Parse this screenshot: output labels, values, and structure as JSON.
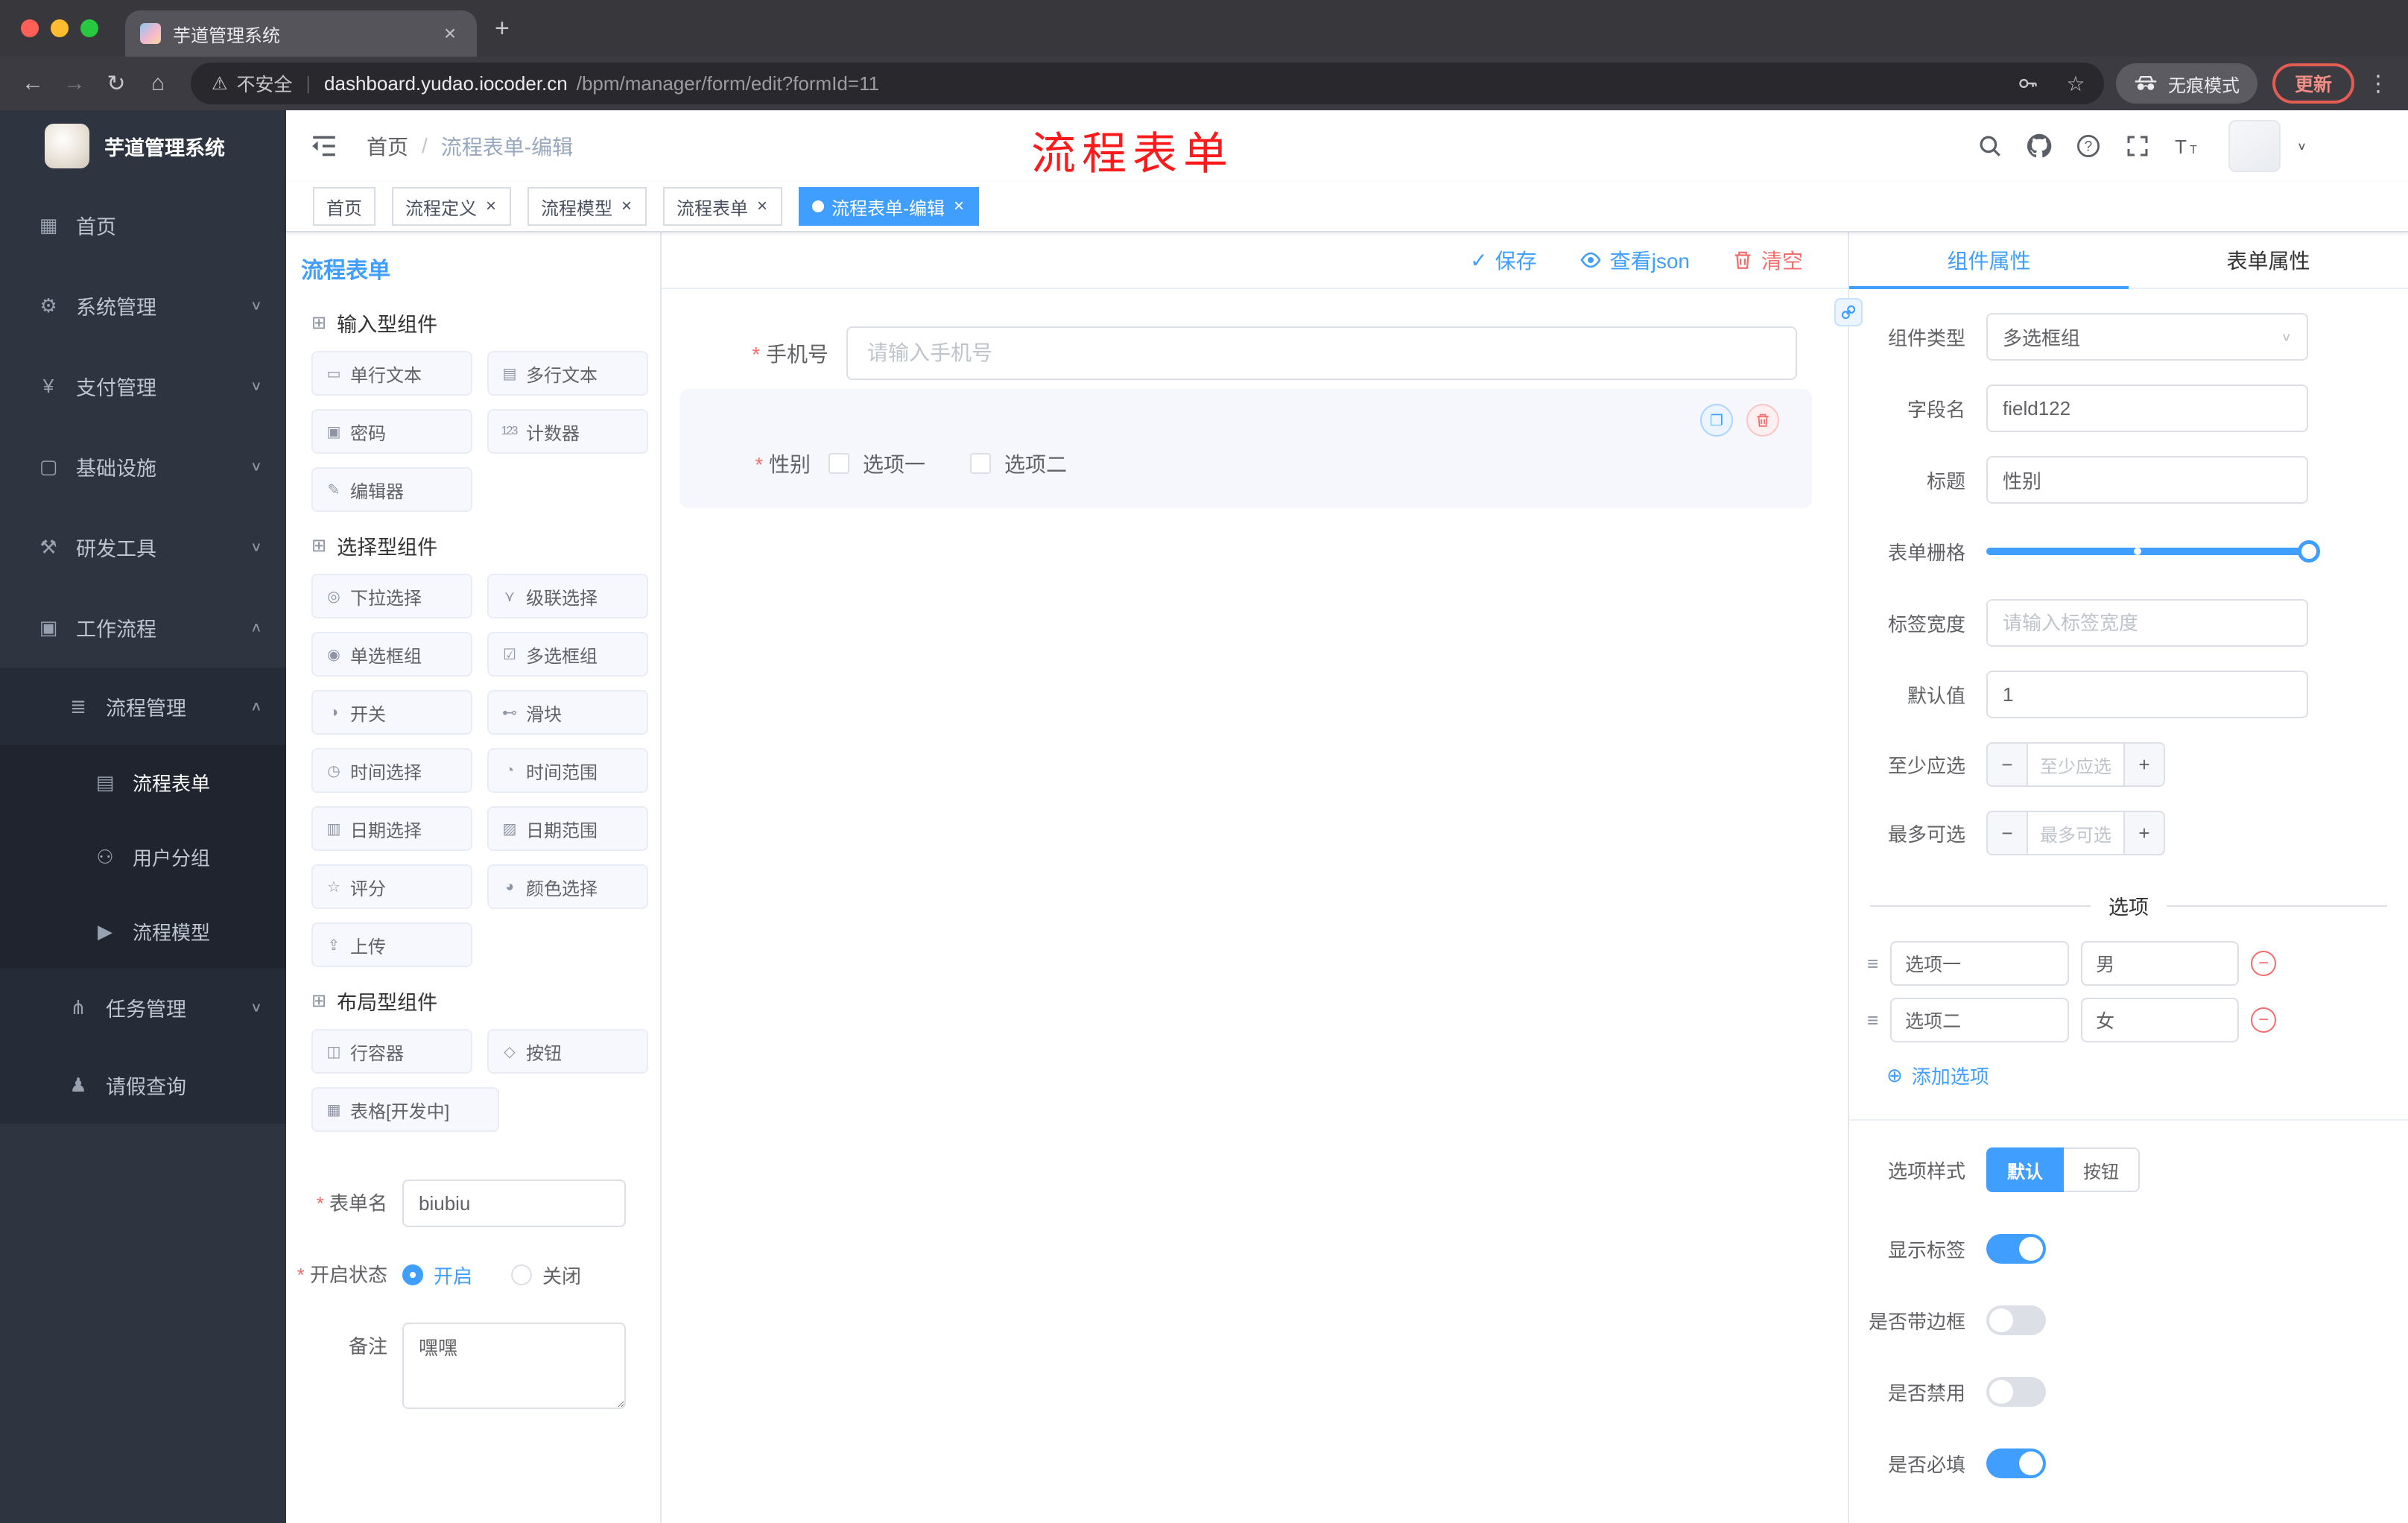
{
  "browser": {
    "tab_title": "芋道管理系统",
    "close_icon": "×",
    "new_tab_icon": "+",
    "back_icon": "←",
    "forward_icon": "→",
    "reload_icon": "↻",
    "home_icon": "⌂",
    "security_icon": "⚠",
    "security_label": "不安全",
    "security_sep": "|",
    "url_host": "dashboard.yudao.iocoder.cn",
    "url_path": "/bpm/manager/form/edit?formId=11",
    "bookmark_icon": "☆",
    "incognito_label": "无痕模式",
    "update_label": "更新",
    "menu_dots_icon": "⋮"
  },
  "sidebar": {
    "logo_title": "芋道管理系统",
    "items": [
      {
        "label": "首页",
        "icon": "▦"
      },
      {
        "label": "系统管理",
        "icon": "⚙",
        "chev": "∨"
      },
      {
        "label": "支付管理",
        "icon": "¥",
        "chev": "∨"
      },
      {
        "label": "基础设施",
        "icon": "▢",
        "chev": "∨"
      },
      {
        "label": "研发工具",
        "icon": "⚒",
        "chev": "∨"
      },
      {
        "label": "工作流程",
        "icon": "▣",
        "chev": "∧"
      },
      {
        "label": "流程管理",
        "icon": "≣",
        "chev": "∧"
      },
      {
        "label": "流程表单",
        "icon": "▤",
        "active": true
      },
      {
        "label": "用户分组",
        "icon": "⚇"
      },
      {
        "label": "流程模型",
        "icon": "▶"
      },
      {
        "label": "任务管理",
        "icon": "⋔",
        "chev": "∨"
      },
      {
        "label": "请假查询",
        "icon": "♟"
      }
    ]
  },
  "header": {
    "breadcrumb_root": "首页",
    "breadcrumb_sep": "/",
    "breadcrumb_current": "流程表单-编辑",
    "annotation": "流程表单",
    "avatar_caret": "∨"
  },
  "tags": {
    "items": [
      {
        "label": "首页"
      },
      {
        "label": "流程定义",
        "close": "×"
      },
      {
        "label": "流程模型",
        "close": "×"
      },
      {
        "label": "流程表单",
        "close": "×"
      },
      {
        "label": "流程表单-编辑",
        "close": "×",
        "active": true
      }
    ]
  },
  "designer": {
    "title": "流程表单",
    "group_icon": "⊞",
    "groups": [
      {
        "title": "输入型组件",
        "items": [
          {
            "label": "单行文本",
            "icon": "▭"
          },
          {
            "label": "多行文本",
            "icon": "▤"
          },
          {
            "label": "密码",
            "icon": "▣"
          },
          {
            "label": "计数器",
            "icon": "123"
          },
          {
            "label": "编辑器",
            "icon": "✎"
          }
        ]
      },
      {
        "title": "选择型组件",
        "items": [
          {
            "label": "下拉选择",
            "icon": "◎"
          },
          {
            "label": "级联选择",
            "icon": "⋎"
          },
          {
            "label": "单选框组",
            "icon": "◉"
          },
          {
            "label": "多选框组",
            "icon": "☑"
          },
          {
            "label": "开关",
            "icon": "◑"
          },
          {
            "label": "滑块",
            "icon": "⊷"
          },
          {
            "label": "时间选择",
            "icon": "◷"
          },
          {
            "label": "时间范围",
            "icon": "◔"
          },
          {
            "label": "日期选择",
            "icon": "▥"
          },
          {
            "label": "日期范围",
            "icon": "▨"
          },
          {
            "label": "评分",
            "icon": "☆"
          },
          {
            "label": "颜色选择",
            "icon": "◕"
          },
          {
            "label": "上传",
            "icon": "⇪"
          }
        ]
      },
      {
        "title": "布局型组件",
        "items": [
          {
            "label": "行容器",
            "icon": "◫"
          },
          {
            "label": "按钮",
            "icon": "◇"
          },
          {
            "label": "表格[开发中]",
            "icon": "▦"
          }
        ]
      }
    ],
    "form": {
      "name_label": "表单名",
      "name_value": "biubiu",
      "status_label": "开启状态",
      "on_label": "开启",
      "on_selected": true,
      "off_label": "关闭",
      "remark_label": "备注",
      "remark_value": "嘿嘿"
    }
  },
  "canvas": {
    "save_icon": "✓",
    "save_label": "保存",
    "view_json_label": "查看json",
    "clear_label": "清空",
    "copy_icon": "❐",
    "phone": {
      "label": "手机号",
      "placeholder": "请输入手机号"
    },
    "gender": {
      "label": "性别",
      "option1": "选项一",
      "option2": "选项二"
    }
  },
  "props": {
    "tab_component": "组件属性",
    "component_tab_active": true,
    "tab_form": "表单属性",
    "component_type": {
      "label": "组件类型",
      "value": "多选框组",
      "chev": "∨"
    },
    "field_name": {
      "label": "字段名",
      "value": "field122"
    },
    "title_field": {
      "label": "标题",
      "value": "性别"
    },
    "grid": {
      "label": "表单栅格"
    },
    "label_width": {
      "label": "标签宽度",
      "placeholder": "请输入标签宽度"
    },
    "default_value": {
      "label": "默认值",
      "value": "1"
    },
    "min_select": {
      "label": "至少应选",
      "placeholder": "至少应选",
      "minus": "−",
      "plus": "+"
    },
    "max_select": {
      "label": "最多可选",
      "placeholder": "最多可选",
      "minus": "−",
      "plus": "+"
    },
    "options": {
      "divider_label": "选项",
      "drag_icon": "≡",
      "remove_icon": "−",
      "rows": [
        {
          "label": "选项一",
          "value": "男"
        },
        {
          "label": "选项二",
          "value": "女"
        }
      ],
      "add_icon": "⊕",
      "add_label": "添加选项"
    },
    "option_style": {
      "label": "选项样式",
      "default_label": "默认",
      "default_active": true,
      "button_label": "按钮"
    },
    "toggles": [
      {
        "label": "显示标签",
        "on": true
      },
      {
        "label": "是否带边框",
        "on": false
      },
      {
        "label": "是否禁用",
        "on": false
      },
      {
        "label": "是否必填",
        "on": true
      }
    ]
  },
  "colors": {
    "primary": "#409eff",
    "danger": "#f56c6c",
    "annotation": "#fe1a1a"
  }
}
